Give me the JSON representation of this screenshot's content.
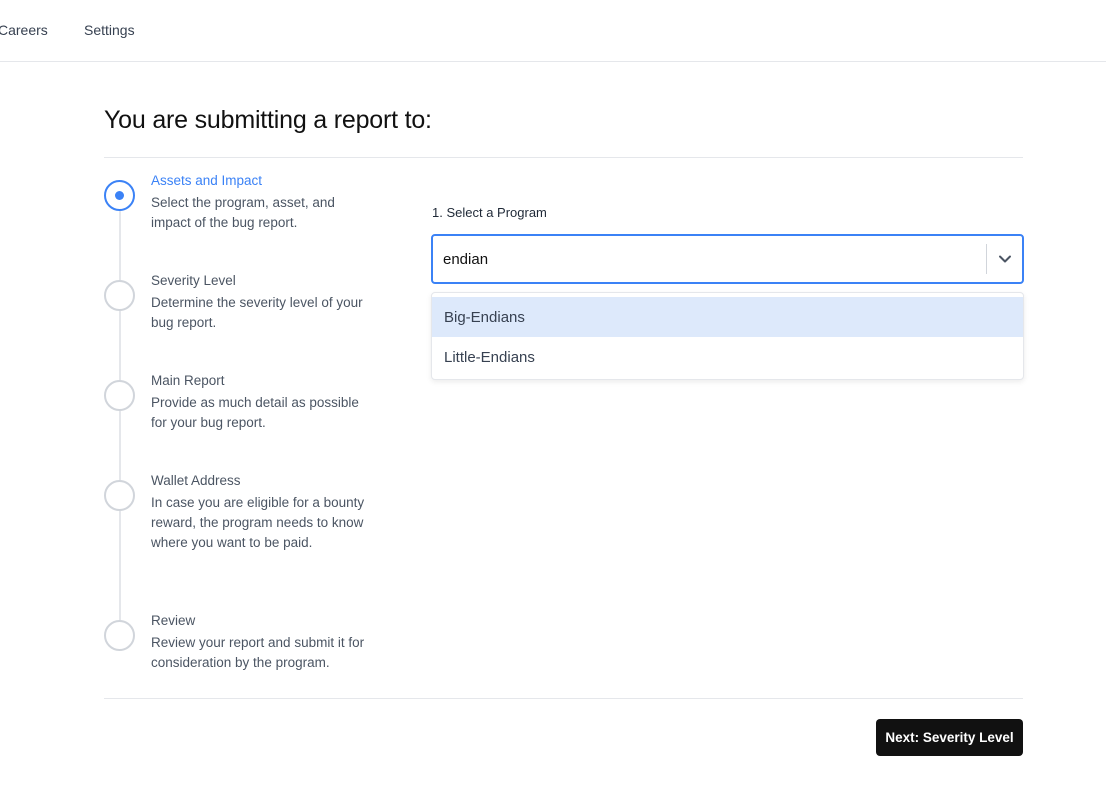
{
  "nav": {
    "items": [
      {
        "label": "Careers"
      },
      {
        "label": "Settings"
      }
    ]
  },
  "page": {
    "title": "You are submitting a report to:"
  },
  "steps": [
    {
      "title": "Assets and Impact",
      "description": "Select the program, asset, and impact of the bug report.",
      "active": true
    },
    {
      "title": "Severity Level",
      "description": "Determine the severity level of your bug report.",
      "active": false
    },
    {
      "title": "Main Report",
      "description": "Provide as much detail as possible for your bug report.",
      "active": false
    },
    {
      "title": "Wallet Address",
      "description": "In case you are eligible for a bounty reward, the program needs to know where you want to be paid.",
      "active": false
    },
    {
      "title": "Review",
      "description": "Review your report and submit it for consideration by the program.",
      "active": false
    }
  ],
  "program_select": {
    "label": "1. Select a Program",
    "value": "endian",
    "caret_icon": "chevron-down-icon",
    "options": [
      {
        "label": "Big-Endians",
        "highlighted": true
      },
      {
        "label": "Little-Endians",
        "highlighted": false
      }
    ]
  },
  "footer": {
    "next_label": "Next: Severity Level"
  },
  "colors": {
    "accent": "#3b82f6",
    "highlight": "#dde9fb",
    "button": "#111111"
  }
}
